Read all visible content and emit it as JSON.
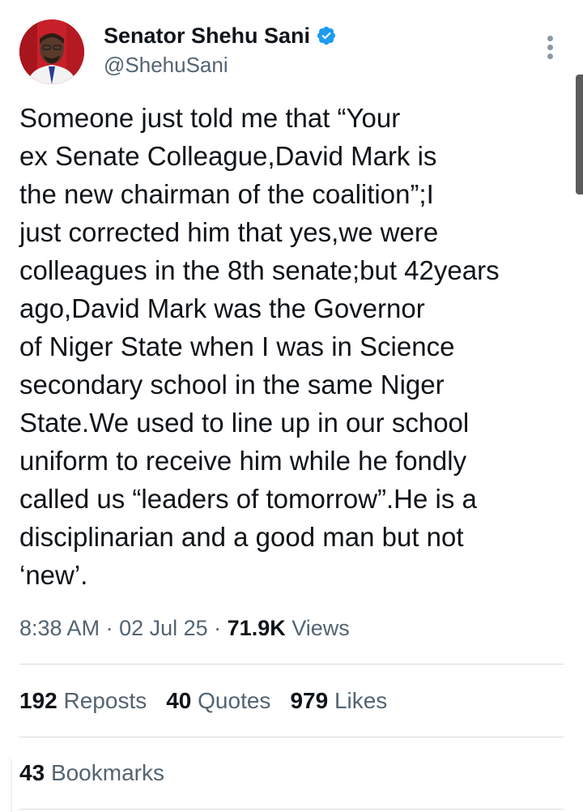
{
  "author": {
    "display_name": "Senator Shehu Sani",
    "handle": "@ShehuSani",
    "verified": true,
    "verified_color": "#1d9bf0"
  },
  "icons": {
    "avatar": "profile-photo",
    "verified": "verified-badge-icon",
    "more": "more-options-icon"
  },
  "tweet": {
    "lines": [
      "Someone just told me that “Your",
      "ex Senate Colleague,David Mark is",
      "the new chairman of the coalition”;I",
      "just corrected him that yes,we were",
      "colleagues in the 8th senate;but 42years",
      "ago,David Mark was the Governor",
      "of Niger State when I was in Science",
      "secondary school in the same Niger",
      "State.We used to line up in our school",
      "uniform to receive him while he fondly",
      "called us “leaders of tomorrow”.He is a",
      "disciplinarian and a good man but not",
      "‘new’."
    ]
  },
  "meta": {
    "time": "8:38 AM",
    "separator": " · ",
    "date": "02 Jul 25",
    "views_count": "71.9K",
    "views_label": "Views"
  },
  "stats": {
    "reposts_count": "192",
    "reposts_label": "Reposts",
    "quotes_count": "40",
    "quotes_label": "Quotes",
    "likes_count": "979",
    "likes_label": "Likes",
    "bookmarks_count": "43",
    "bookmarks_label": "Bookmarks"
  }
}
